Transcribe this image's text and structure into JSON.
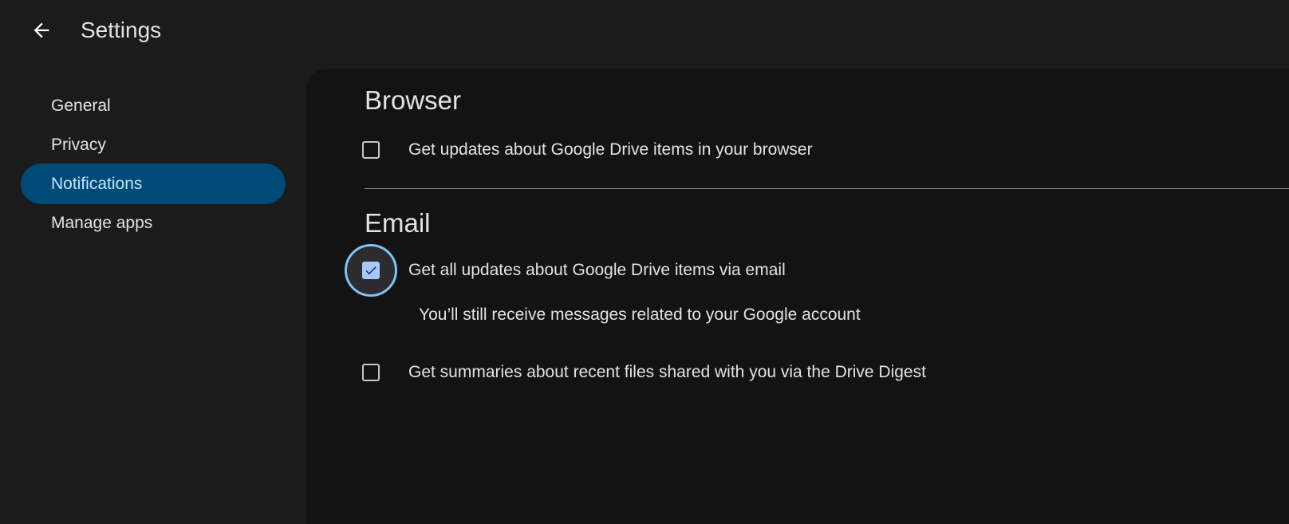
{
  "header": {
    "title": "Settings"
  },
  "sidebar": {
    "items": [
      {
        "label": "General",
        "active": false
      },
      {
        "label": "Privacy",
        "active": false
      },
      {
        "label": "Notifications",
        "active": true
      },
      {
        "label": "Manage apps",
        "active": false
      }
    ]
  },
  "browser": {
    "title": "Browser",
    "items": [
      {
        "label": "Get updates about Google Drive items in your browser",
        "checked": false
      }
    ]
  },
  "email": {
    "title": "Email",
    "items": [
      {
        "label": "Get all updates about Google Drive items via email",
        "checked": true,
        "helper": "You’ll still receive messages related to your Google account"
      },
      {
        "label": "Get summaries about recent files shared with you via the Drive Digest",
        "checked": false
      }
    ]
  },
  "colors": {
    "background": "#1b1b1b",
    "panel": "#131313",
    "active_nav": "#004a77",
    "checkbox_checked": "#a8c7fa",
    "focus_ring": "#7cc4fa"
  },
  "icons": {
    "back": "arrow-back-icon",
    "check": "check-icon"
  }
}
